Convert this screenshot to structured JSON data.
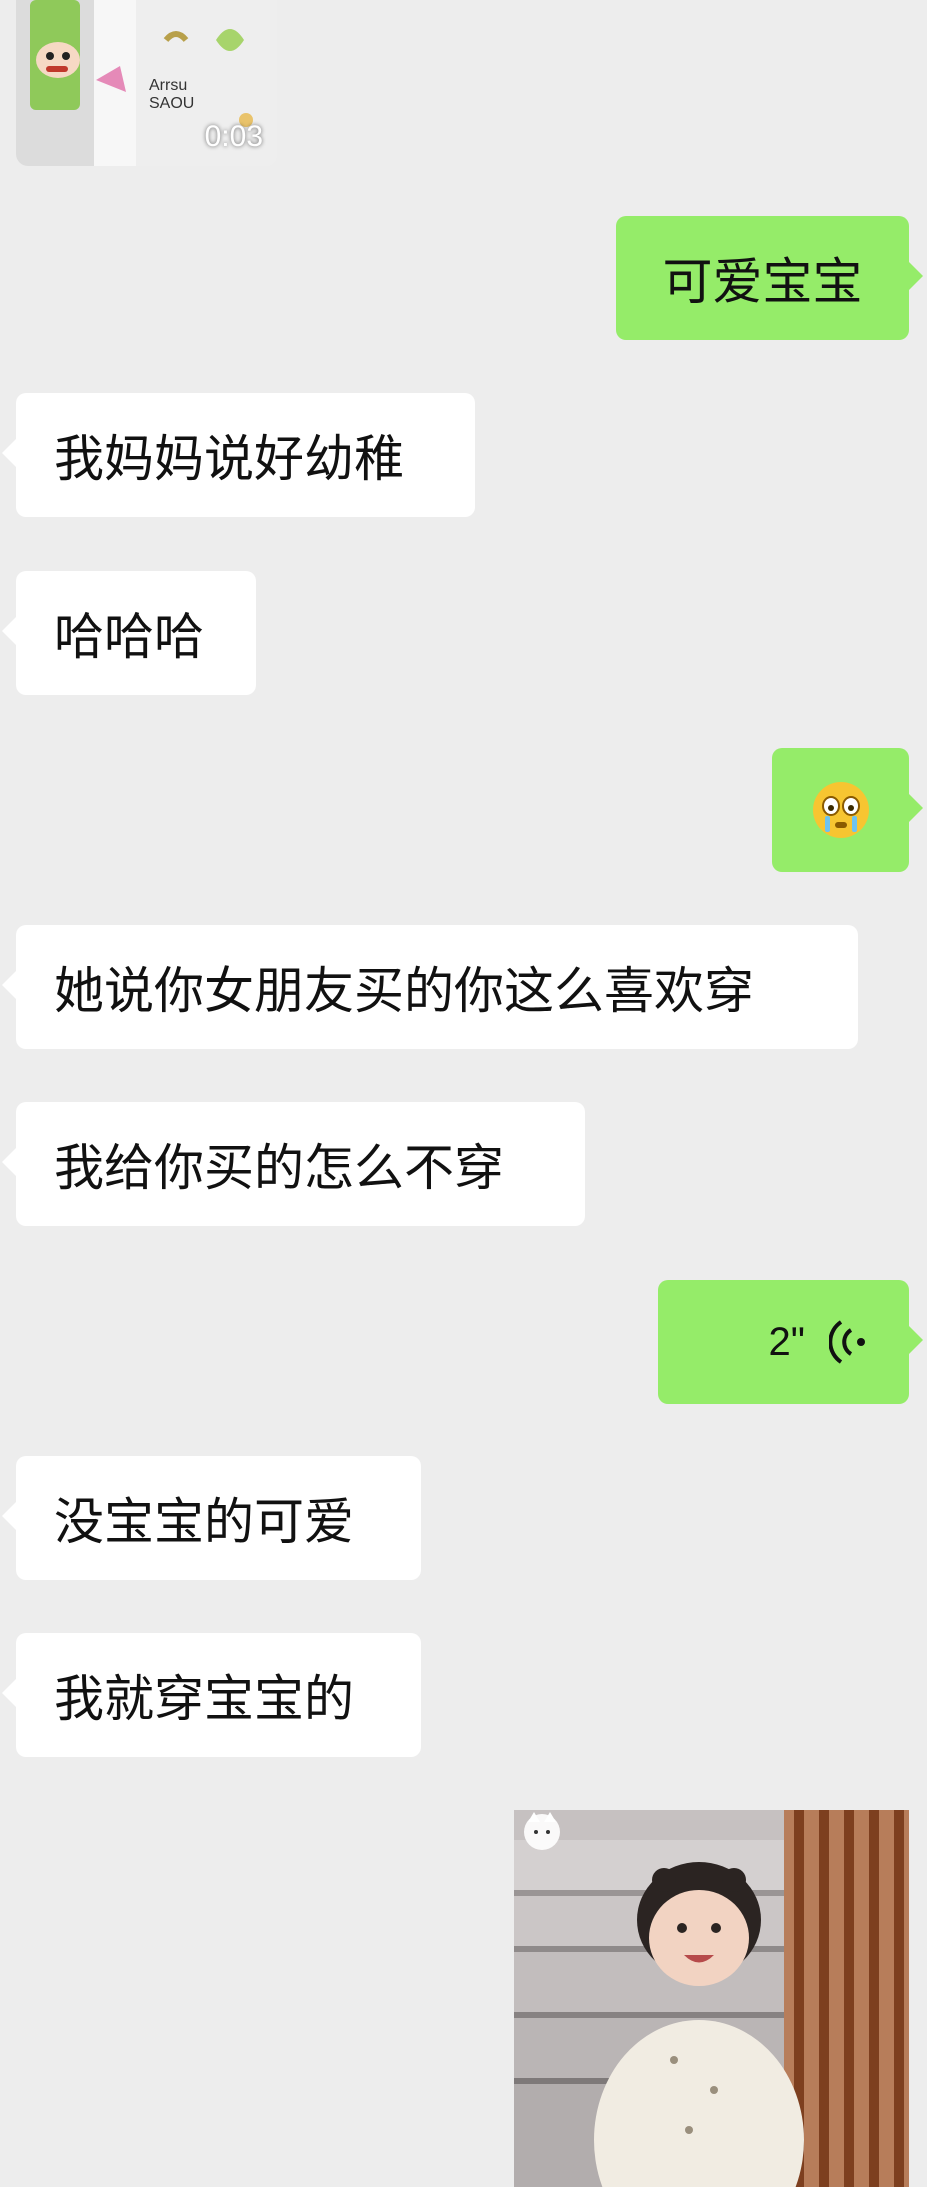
{
  "video": {
    "duration": "0:03"
  },
  "messages": [
    {
      "side": "out",
      "text": "可爱宝宝"
    },
    {
      "side": "in",
      "text": "我妈妈说好幼稚"
    },
    {
      "side": "in",
      "text": "哈哈哈"
    },
    {
      "side": "out",
      "emoji": "cry-laugh-emoji-icon"
    },
    {
      "side": "in",
      "text": "她说你女朋友买的你这么喜欢穿"
    },
    {
      "side": "in",
      "text": "我给你买的怎么不穿"
    },
    {
      "side": "out",
      "voice_duration": "2\""
    },
    {
      "side": "in",
      "text": "没宝宝的可爱"
    },
    {
      "side": "in",
      "text": "我就穿宝宝的"
    }
  ],
  "colors": {
    "outgoing": "#95ec69",
    "incoming": "#ffffff",
    "background": "#ededed"
  }
}
